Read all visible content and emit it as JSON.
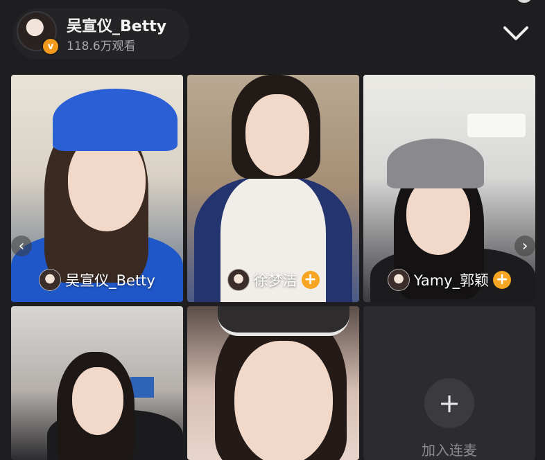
{
  "header": {
    "host_name": "吴宣仪_Betty",
    "views": "118.6万观看",
    "verified_badge": "v",
    "collapse_icon": "chevron-down-icon"
  },
  "tiles": [
    {
      "name": "吴宣仪_Betty",
      "has_avatar": true,
      "has_follow": false
    },
    {
      "name": "徐梦洁",
      "has_avatar": true,
      "has_follow": true
    },
    {
      "name": "Yamy_郭颖",
      "has_avatar": true,
      "has_follow": true
    },
    {
      "name": "",
      "has_avatar": false,
      "has_follow": false
    },
    {
      "name": "",
      "has_avatar": false,
      "has_follow": false
    }
  ],
  "add_slot": {
    "icon": "+",
    "label": "加入连麦"
  },
  "nav": {
    "prev": "‹",
    "next": "›"
  },
  "follow_symbol": "+",
  "colors": {
    "background": "#1e1e20",
    "follow": "#f6a623",
    "badge": "#f39a1d"
  }
}
